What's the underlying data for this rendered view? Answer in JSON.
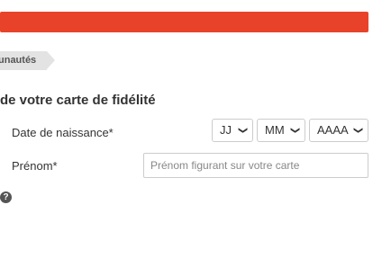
{
  "colors": {
    "brand_bar": "#e8432a",
    "breadcrumb_bg": "#e3e3e3",
    "text": "#333333"
  },
  "breadcrumb": {
    "label": "unautés"
  },
  "form": {
    "title": "de votre carte de fidélité",
    "birthdate": {
      "label": "Date de naissance*",
      "day_value": "JJ",
      "month_value": "MM",
      "year_value": "AAAA"
    },
    "firstname": {
      "label": "Prénom*",
      "placeholder": "Prénom figurant sur votre carte"
    },
    "help_icon": "question-circle-icon",
    "help_glyph": "?"
  }
}
